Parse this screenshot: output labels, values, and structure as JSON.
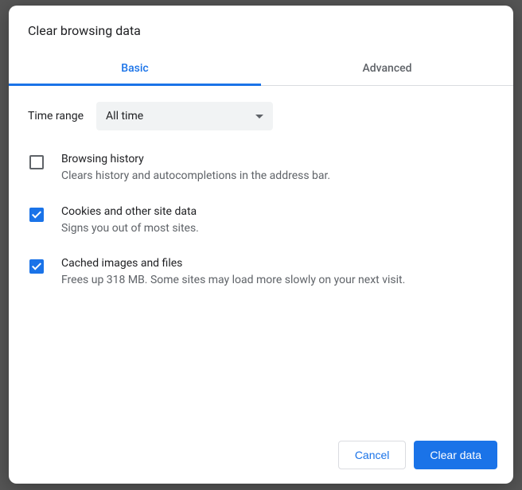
{
  "dialog": {
    "title": "Clear browsing data"
  },
  "tabs": {
    "basic": "Basic",
    "advanced": "Advanced"
  },
  "timeRange": {
    "label": "Time range",
    "value": "All time"
  },
  "options": {
    "history": {
      "title": "Browsing history",
      "desc": "Clears history and autocompletions in the address bar.",
      "checked": false
    },
    "cookies": {
      "title": "Cookies and other site data",
      "desc": "Signs you out of most sites.",
      "checked": true
    },
    "cache": {
      "title": "Cached images and files",
      "desc": "Frees up 318 MB. Some sites may load more slowly on your next visit.",
      "checked": true
    }
  },
  "buttons": {
    "cancel": "Cancel",
    "clear": "Clear data"
  }
}
